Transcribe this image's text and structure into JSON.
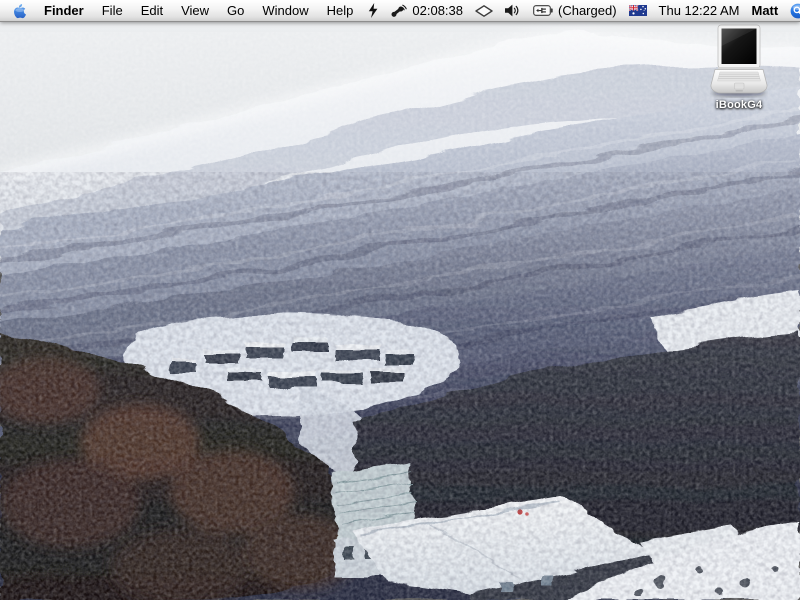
{
  "menu_bar": {
    "menus": [
      {
        "label": "Finder",
        "bold": true
      },
      {
        "label": "File"
      },
      {
        "label": "Edit"
      },
      {
        "label": "View"
      },
      {
        "label": "Go"
      },
      {
        "label": "Window"
      },
      {
        "label": "Help"
      }
    ],
    "status": {
      "connection_timer": "02:08:38",
      "battery_status": "(Charged)",
      "clock": "Thu 12:22 AM",
      "user_name": "Matt"
    },
    "icons": {
      "apple": "apple-logo-blue",
      "sync": "lightning-bolt-icon",
      "modem": "phone-receiver-icon",
      "airport": "airport-diamond-icon",
      "volume": "speaker-volume-icon",
      "battery": "battery-plugged-icon",
      "input": "australian-flag-icon",
      "spotlight": "spotlight-magnifier-icon"
    },
    "colors": {
      "apple_blue": "#3f84e0",
      "spotlight_blue": "#2273e2",
      "bar_background": "#ececec"
    }
  },
  "desktop": {
    "icons": [
      {
        "label": "iBookG4",
        "type": "ibook-laptop-volume-icon"
      }
    ],
    "wallpaper": {
      "description": "Aerial photo of a snow-covered mountainside with parallel tree-lined ridges descending diagonally, a small ski village in a clearing mid-left, dark snow-dusted eucalyptus trees in the foreground and snowy lodge roofs at the bottom",
      "palette": {
        "sky": "#e6e8eb",
        "snow_bright": "#f4f5f7",
        "ridge_mid": "#8b93a6",
        "ridge_dark": "#3c4155",
        "trees_dark": "#1d1b1c",
        "foliage_brown": "#57382c"
      }
    }
  }
}
